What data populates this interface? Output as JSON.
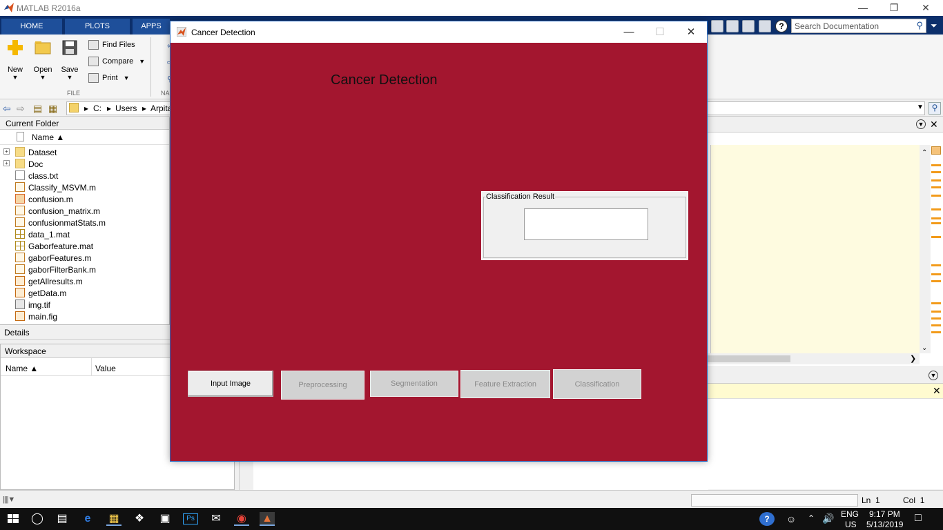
{
  "matlab": {
    "title": "MATLAB R2016a",
    "tabs": [
      "HOME",
      "PLOTS",
      "APPS"
    ],
    "search_placeholder": "Search Documentation",
    "ribbon": {
      "new": "New",
      "open": "Open",
      "save": "Save",
      "find_files": "Find Files",
      "compare": "Compare",
      "print": "Print",
      "file_group": "FILE",
      "nav_group": "NA"
    },
    "path": [
      "C:",
      "Users",
      "Arpita"
    ],
    "current_folder": {
      "title": "Current Folder",
      "name_col": "Name ▲",
      "files": [
        {
          "name": "Dataset",
          "type": "folder"
        },
        {
          "name": "Doc",
          "type": "folder"
        },
        {
          "name": "class.txt",
          "type": "txt"
        },
        {
          "name": "Classify_MSVM.m",
          "type": "mfile"
        },
        {
          "name": "confusion.m",
          "type": "app"
        },
        {
          "name": "confusion_matrix.m",
          "type": "mfile"
        },
        {
          "name": "confusionmatStats.m",
          "type": "mfile"
        },
        {
          "name": "data_1.mat",
          "type": "mat"
        },
        {
          "name": "Gaborfeature.mat",
          "type": "mat"
        },
        {
          "name": "gaborFeatures.m",
          "type": "mfile"
        },
        {
          "name": "gaborFilterBank.m",
          "type": "mfile"
        },
        {
          "name": "getAllresults.m",
          "type": "fig"
        },
        {
          "name": "getData.m",
          "type": "fig"
        },
        {
          "name": "img.tif",
          "type": "img"
        },
        {
          "name": "main.fig",
          "type": "fig"
        }
      ]
    },
    "details": "Details",
    "workspace": {
      "title": "Workspace",
      "name_col": "Name ▲",
      "value_col": "Value"
    },
    "status": {
      "ln_label": "Ln",
      "ln": "1",
      "col_label": "Col",
      "col": "1"
    }
  },
  "dialog": {
    "title": "Cancer Detection",
    "heading": "Cancer Detection",
    "result_group": "Classification Result",
    "result_value": "",
    "buttons": [
      {
        "label": "Input Image",
        "enabled": true
      },
      {
        "label": "Preprocessing",
        "enabled": false
      },
      {
        "label": "Segmentation",
        "enabled": false
      },
      {
        "label": "Feature Extraction",
        "enabled": false
      },
      {
        "label": "Classification",
        "enabled": false
      }
    ],
    "background_color": "#a3162f"
  },
  "taskbar": {
    "lang": "ENG",
    "region": "US",
    "time": "9:17 PM",
    "date": "5/13/2019"
  }
}
